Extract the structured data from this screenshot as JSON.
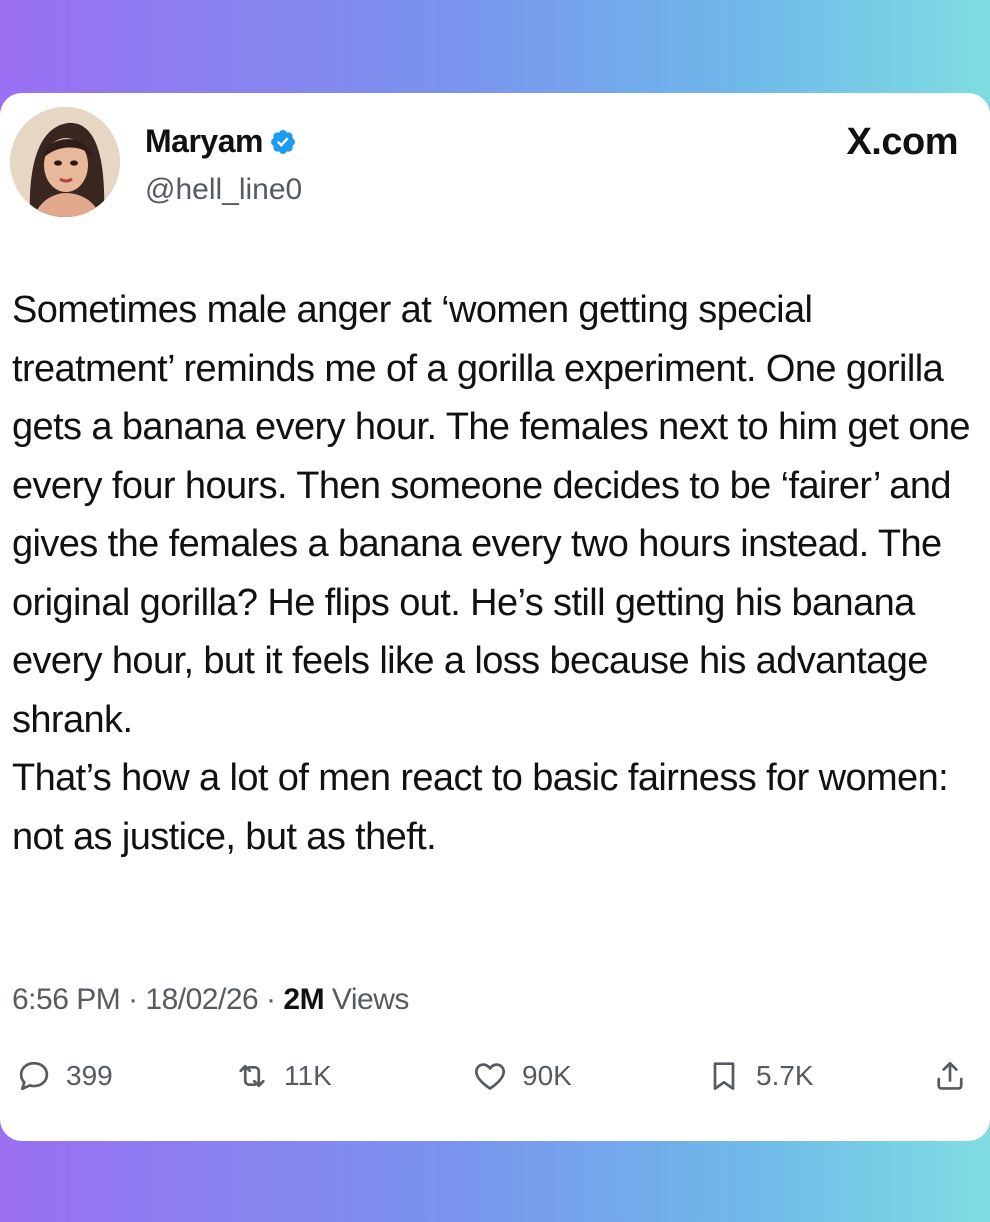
{
  "post": {
    "author_name": "Maryam",
    "author_handle": "@hell_line0",
    "brand_label": "X.com",
    "paragraphs": [
      "Sometimes male anger at ‘women getting special treatment’ reminds me of a gorilla experiment. One gorilla gets a banana every hour. The females next to him get one every four hours. Then someone decides to be ‘fairer’ and gives the females a banana every two hours instead. The original gorilla? He flips out. He’s still getting his banana every hour, but it feels like a loss because his advantage shrank.",
      "That’s how a lot of men react to basic fairness for women: not as justice, but as theft."
    ],
    "time": "6:56 PM",
    "date": "18/02/26",
    "separator": "·",
    "views_count": "2M",
    "views_label": "Views"
  },
  "actions": {
    "replies": "399",
    "reposts": "11K",
    "likes": "90K",
    "bookmarks": "5.7K"
  },
  "icons": {
    "verified": "verified-badge-icon",
    "reply": "reply-icon",
    "repost": "repost-icon",
    "like": "heart-icon",
    "bookmark": "bookmark-icon",
    "share": "share-icon"
  },
  "colors": {
    "verified_blue": "#1d9bf0",
    "text_primary": "#111111",
    "text_secondary": "#555b61"
  }
}
